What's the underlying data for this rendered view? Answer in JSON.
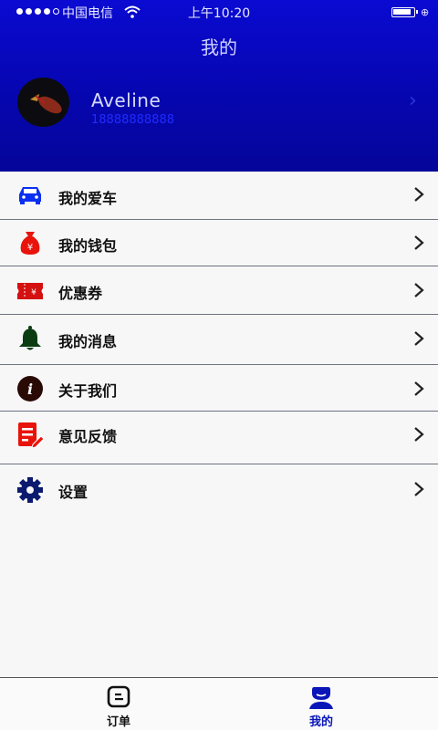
{
  "status_bar": {
    "carrier": "中国电信",
    "time": "上午10:20"
  },
  "header": {
    "title": "我的",
    "user_name": "Aveline",
    "user_phone": "18888888888"
  },
  "menu": [
    {
      "label": "我的爱车",
      "icon": "car-icon",
      "color": "#0a2ff0"
    },
    {
      "label": "我的钱包",
      "icon": "money-bag-icon",
      "color": "#e8140c"
    },
    {
      "label": "优惠券",
      "icon": "coupon-icon",
      "color": "#d41010"
    },
    {
      "label": "我的消息",
      "icon": "bell-icon",
      "color": "#0c3d12"
    },
    {
      "label": "关于我们",
      "icon": "info-icon",
      "color": "#2a0a05"
    },
    {
      "label": "意见反馈",
      "icon": "feedback-icon",
      "color": "#e8140c"
    },
    {
      "label": "设置",
      "icon": "gear-icon",
      "color": "#0b1a6e"
    }
  ],
  "tabbar": {
    "tabs": [
      {
        "label": "订单",
        "icon": "order-icon",
        "active": false
      },
      {
        "label": "我的",
        "icon": "profile-icon",
        "active": true
      }
    ],
    "active_color": "#0a16b8"
  }
}
